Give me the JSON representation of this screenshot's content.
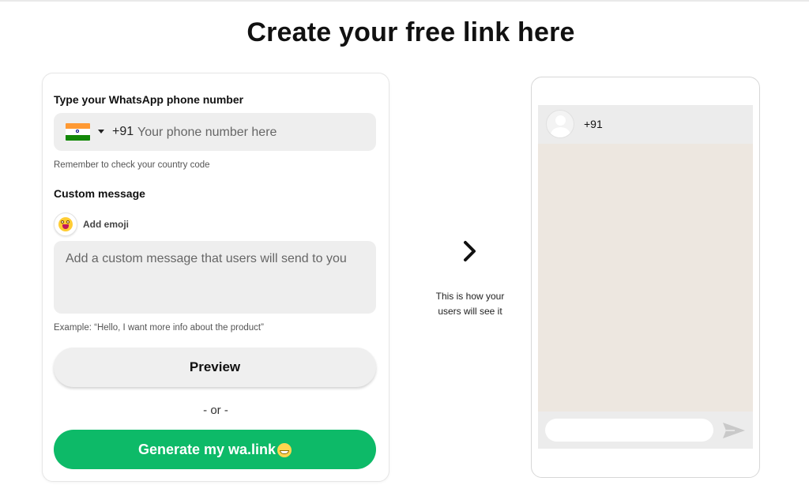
{
  "page": {
    "title": "Create your free link here"
  },
  "form": {
    "phone_label": "Type your WhatsApp phone number",
    "country": {
      "flag_icon": "india-flag-icon",
      "dial_code": "+91"
    },
    "phone_placeholder": "Your phone number here",
    "phone_hint": "Remember to check your country code",
    "message_label": "Custom message",
    "emoji_label": "Add emoji",
    "message_placeholder": "Add a custom message that users will send to you",
    "message_example": "Example: “Hello, I want more info about the product”",
    "preview_label": "Preview",
    "or_text": "- or -",
    "generate_label": "Generate my wa.link",
    "generate_color": "#0dba68"
  },
  "middle": {
    "arrow_icon": "chevron-right-icon",
    "caption_line1": "This is how your",
    "caption_line2": "users will see it"
  },
  "preview_phone": {
    "contact_number": "+91",
    "chat_background": "#ede7e0",
    "send_icon": "send-icon"
  }
}
